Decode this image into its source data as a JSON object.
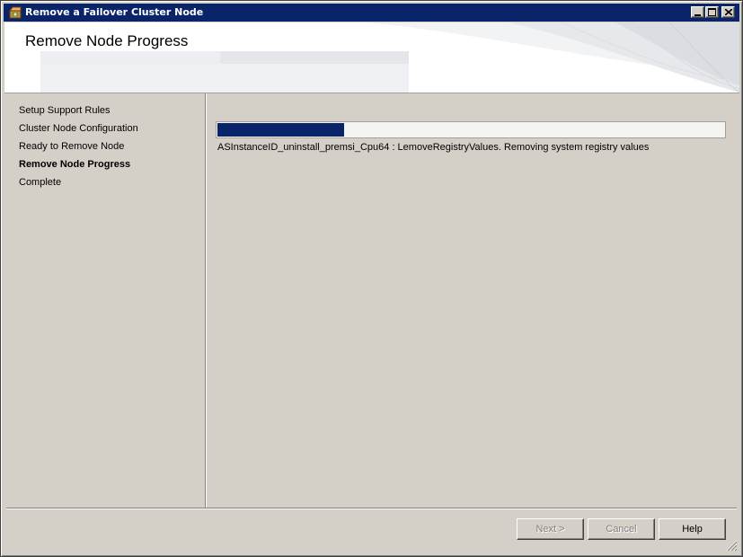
{
  "window": {
    "title": "Remove a Failover Cluster Node",
    "accent_color": "#0a246a"
  },
  "header": {
    "title": "Remove Node Progress"
  },
  "sidebar": {
    "items": [
      {
        "label": "Setup Support Rules",
        "active": false
      },
      {
        "label": "Cluster Node Configuration",
        "active": false
      },
      {
        "label": "Ready to Remove Node",
        "active": false
      },
      {
        "label": "Remove Node Progress",
        "active": true
      },
      {
        "label": "Complete",
        "active": false
      }
    ]
  },
  "main": {
    "progress_fraction": 0.25,
    "status_text": "ASInstanceID_uninstall_premsi_Cpu64 : LemoveRegistryValues. Removing system registry values"
  },
  "footer": {
    "next_label": "Next >",
    "cancel_label": "Cancel",
    "help_label": "Help"
  }
}
